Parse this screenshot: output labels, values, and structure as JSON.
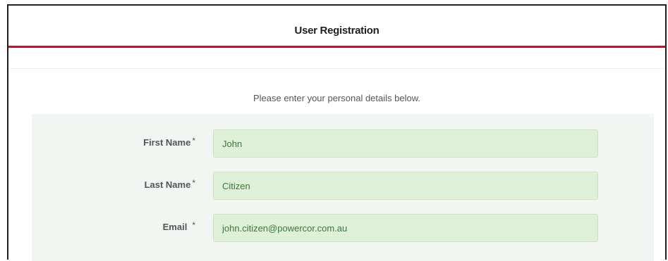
{
  "header": {
    "title": "User Registration"
  },
  "intro_text": "Please enter your personal details below.",
  "form": {
    "fields": [
      {
        "label": "First Name",
        "required_mark": "*",
        "value": "John"
      },
      {
        "label": "Last Name",
        "required_mark": "*",
        "value": "Citizen"
      },
      {
        "label": "Email",
        "required_mark": "*",
        "value": "john.citizen@powercor.com.au"
      }
    ]
  },
  "colors": {
    "accent_rule": "#c8102e",
    "valid_field_bg": "#dff0d8",
    "valid_field_text": "#3c763d"
  }
}
